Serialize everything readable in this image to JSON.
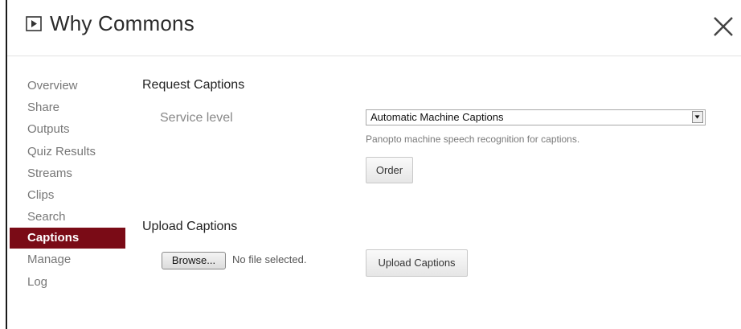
{
  "header": {
    "title": "Why Commons",
    "play_icon": "play-box-icon",
    "close_icon": "close-icon"
  },
  "sidebar": {
    "items": [
      {
        "label": "Overview",
        "active": false
      },
      {
        "label": "Share",
        "active": false
      },
      {
        "label": "Outputs",
        "active": false
      },
      {
        "label": "Quiz Results",
        "active": false
      },
      {
        "label": "Streams",
        "active": false
      },
      {
        "label": "Clips",
        "active": false
      },
      {
        "label": "Search",
        "active": false
      },
      {
        "label": "Captions",
        "active": true
      },
      {
        "label": "Manage",
        "active": false
      },
      {
        "label": "Log",
        "active": false
      }
    ]
  },
  "request_captions": {
    "title": "Request Captions",
    "service_level_label": "Service level",
    "service_level_value": "Automatic Machine Captions",
    "help_text": "Panopto machine speech recognition for captions.",
    "order_label": "Order"
  },
  "upload_captions": {
    "title": "Upload Captions",
    "browse_label": "Browse...",
    "file_status": "No file selected.",
    "upload_label": "Upload Captions"
  },
  "colors": {
    "active_nav_bg": "#7a0b16",
    "active_nav_text": "#ffffff",
    "nav_text": "#777777"
  }
}
